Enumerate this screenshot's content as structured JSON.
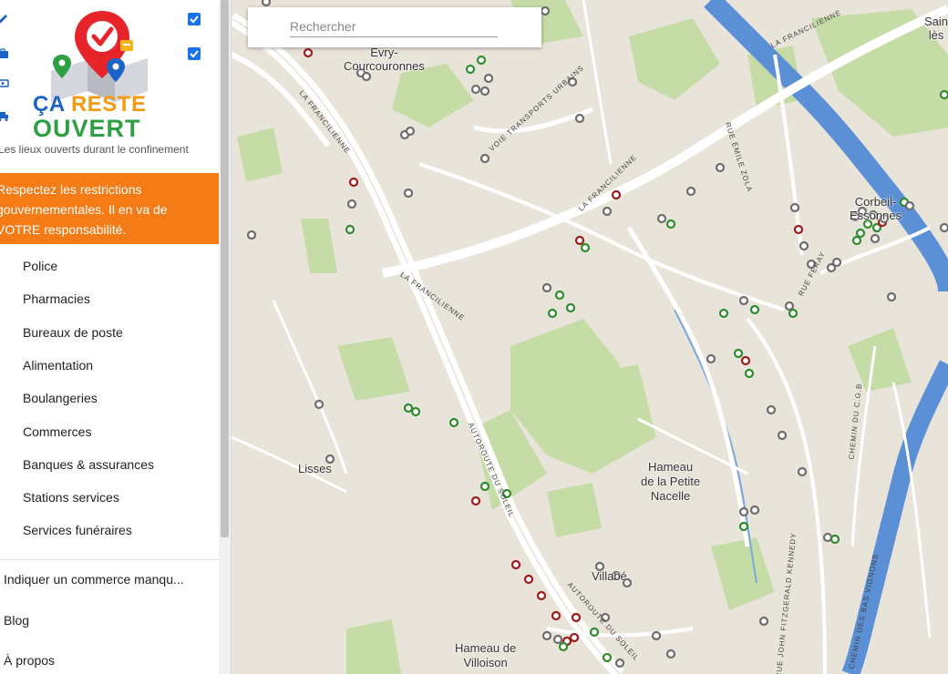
{
  "app": {
    "logo_text_line1_a": "ÇA",
    "logo_text_line1_b": "RESTE",
    "logo_text_line2": "OUVERT",
    "tagline": "Les lieux ouverts durant le confinement"
  },
  "warning": {
    "line1": "Respectez les restrictions",
    "line2": "gouvernementales. Il en va de",
    "line3": "VOTRE responsabilité."
  },
  "categories": [
    "Police",
    "Pharmacies",
    "Bureaux de poste",
    "Alimentation",
    "Boulangeries",
    "Commerces",
    "Banques & assurances",
    "Stations services",
    "Services funéraires"
  ],
  "links": {
    "report": "Indiquer un commerce manqu...",
    "blog": "Blog",
    "about": "À propos"
  },
  "search": {
    "placeholder": "Rechercher"
  },
  "map": {
    "places": {
      "evry": "Évry-\nCourcouronnes",
      "lisses": "Lisses",
      "hameau_nacelle": "Hameau\nde la Petite\nNacelle",
      "villabe": "Villabé",
      "hameau_villoison": "Hameau de\nVilloison",
      "corbeil": "Corbeil-\nEssonnes",
      "saint": "Sain\nlès"
    },
    "roads": {
      "francilienne": "LA FRANCILIENNE",
      "autoroute_soleil": "AUTOROUTE DU SOLEIL",
      "voie_transports": "VOIE TRANSPORTS URBAINS",
      "rue_zola": "RUE ÉMILE ZOLA",
      "rue_feray": "RUE FERAY",
      "chemin_cgb": "CHEMIN DU C.G.B",
      "rue_kennedy": "RUE JOHN FITZGERALD KENNEDY",
      "chemin_vignons": "CHEMIN DES BAS VIGNONS"
    },
    "marker_colors": {
      "grey": "#6d6d6d",
      "green": "#2e8b2e",
      "red": "#9b1c1c"
    }
  },
  "colors": {
    "warning_bg": "#f47b16",
    "checkbox": "#1a73e8",
    "river": "#5b8fd6",
    "park": "#c6dca6",
    "road": "#ffffff"
  }
}
